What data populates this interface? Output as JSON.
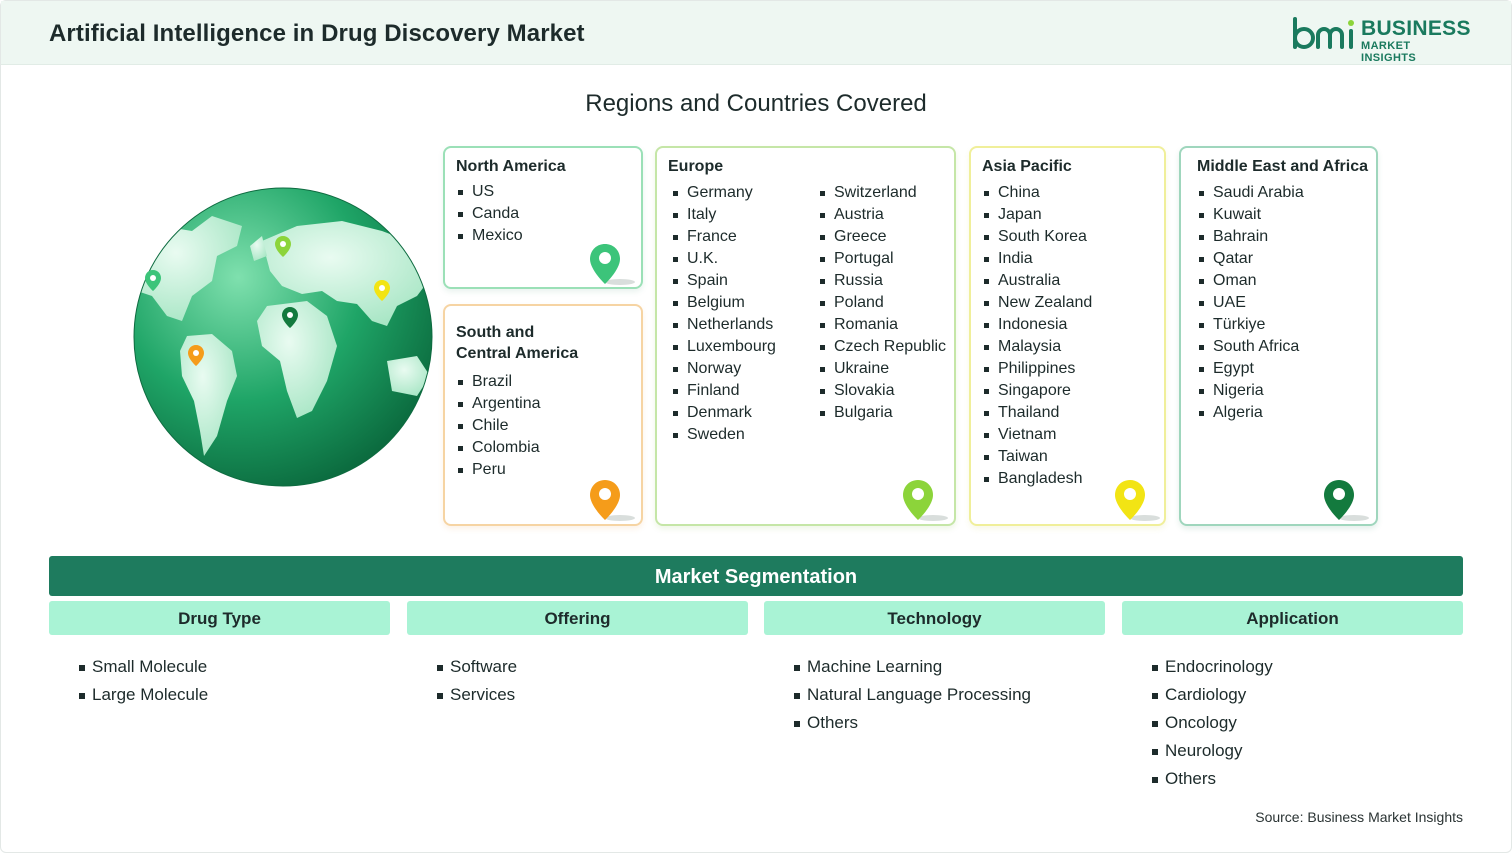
{
  "header": {
    "title": "Artificial Intelligence in Drug Discovery Market",
    "logo_text_1": "BUSINESS",
    "logo_text_2": "MARKET INSIGHTS",
    "logo_mark": "bmi"
  },
  "regions_title": "Regions and Countries Covered",
  "regions": {
    "north_america": {
      "title": "North America",
      "items": [
        "US",
        "Canda",
        "Mexico"
      ]
    },
    "south_central_america": {
      "title_line1": "South and",
      "title_line2": "Central America",
      "items": [
        "Brazil",
        "Argentina",
        "Chile",
        "Colombia",
        "Peru"
      ]
    },
    "europe": {
      "title": "Europe",
      "col1": [
        "Germany",
        "Italy",
        "France",
        "U.K.",
        "Spain",
        "Belgium",
        "Netherlands",
        "Luxembourg",
        "Norway",
        "Finland",
        "Denmark",
        "Sweden"
      ],
      "col2": [
        "Switzerland",
        "Austria",
        "Greece",
        "Portugal",
        "Russia",
        "Poland",
        "Romania",
        "Czech Republic",
        "Ukraine",
        "Slovakia",
        "Bulgaria"
      ]
    },
    "asia_pacific": {
      "title": "Asia Pacific",
      "items": [
        "China",
        "Japan",
        "South Korea",
        "India",
        "Australia",
        "New Zealand",
        "Indonesia",
        "Malaysia",
        "Philippines",
        "Singapore",
        "Thailand",
        "Vietnam",
        "Taiwan",
        "Bangladesh"
      ]
    },
    "mea": {
      "title": "Middle East and Africa",
      "items": [
        "Saudi Arabia",
        "Kuwait",
        "Bahrain",
        "Qatar",
        "Oman",
        "UAE",
        "Türkiye",
        "South Africa",
        "Egypt",
        "Nigeria",
        "Algeria"
      ]
    }
  },
  "segmentation": {
    "title": "Market Segmentation",
    "columns": [
      {
        "head": "Drug Type",
        "items": [
          "Small Molecule",
          "Large Molecule"
        ]
      },
      {
        "head": "Offering",
        "items": [
          "Software",
          "Services"
        ]
      },
      {
        "head": "Technology",
        "items": [
          "Machine Learning",
          "Natural Language Processing",
          "Others"
        ]
      },
      {
        "head": "Application",
        "items": [
          "Endocrinology",
          "Cardiology",
          "Oncology",
          "Neurology",
          "Others"
        ]
      }
    ]
  },
  "source": "Source: Business Market Insights",
  "colors": {
    "brand": "#1a7a5e",
    "segment_bar": "#1e7b5e",
    "segment_head": "#a9f3d5",
    "pin_green": "#3cc47a",
    "pin_orange": "#f59c1a",
    "pin_lime": "#8cd43a",
    "pin_yellow": "#f2e414",
    "pin_dark_green": "#137a3e"
  },
  "icons": [
    "globe-icon",
    "map-pin-icon"
  ]
}
